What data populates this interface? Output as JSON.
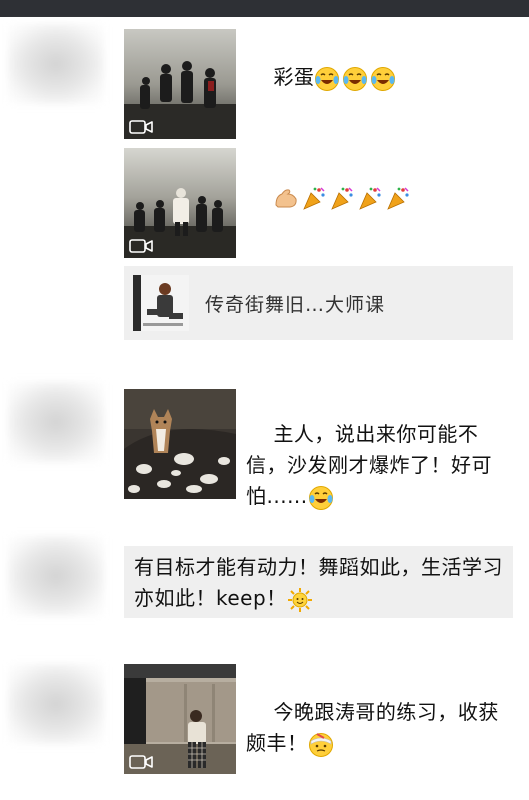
{
  "colors": {
    "top_bar": "#2e3035",
    "card_bg": "#efefef",
    "page_bg": "#ffffff"
  },
  "posts": [
    {
      "text": "彩蛋",
      "emoji_icons": [
        "laughing-tears-emoji",
        "laughing-tears-emoji",
        "laughing-tears-emoji"
      ],
      "media": "video"
    },
    {
      "text": "",
      "emoji_icons": [
        "flexed-biceps-emoji",
        "party-popper-emoji",
        "party-popper-emoji",
        "party-popper-emoji",
        "party-popper-emoji"
      ],
      "media": "video"
    },
    {
      "link_title": "传奇街舞旧…大师课"
    },
    {
      "text": "主人，说出来你可能不信，沙发刚才爆炸了！好可怕......",
      "emoji_icons": [
        "laughing-tears-emoji"
      ],
      "media": "image"
    },
    {
      "text": "有目标才能有动力！舞蹈如此，生活学习亦如此！keep！",
      "emoji_icons": [
        "sun-emoji"
      ]
    },
    {
      "text": "今晚跟涛哥的练习，收获颇丰！",
      "emoji_icons": [
        "bandaged-face-emoji"
      ],
      "media": "video"
    }
  ]
}
